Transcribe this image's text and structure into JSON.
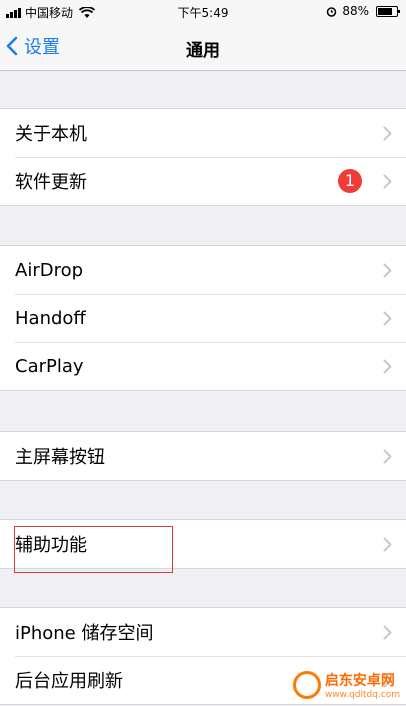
{
  "status_bar": {
    "carrier": "中国移动",
    "time": "下午5:49",
    "battery_percent": "88%",
    "battery_level": 0.88,
    "icons": [
      "signal-icon",
      "wifi-icon",
      "alarm-icon",
      "battery-icon"
    ]
  },
  "nav": {
    "back_label": "设置",
    "title": "通用"
  },
  "groups": [
    {
      "rows": [
        {
          "label": "关于本机"
        },
        {
          "label": "软件更新",
          "badge": "1"
        }
      ]
    },
    {
      "rows": [
        {
          "label": "AirDrop"
        },
        {
          "label": "Handoff"
        },
        {
          "label": "CarPlay"
        }
      ]
    },
    {
      "rows": [
        {
          "label": "主屏幕按钮"
        }
      ]
    },
    {
      "rows": [
        {
          "label": "辅助功能"
        }
      ]
    },
    {
      "rows": [
        {
          "label": "iPhone 储存空间"
        },
        {
          "label": "后台应用刷新"
        }
      ]
    }
  ],
  "watermark": {
    "title": "启东安卓网",
    "url": "www.qdltdq.com"
  },
  "colors": {
    "accent": "#1a7df3",
    "badge": "#f13b36",
    "highlight": "#d93b3b",
    "background": "#efeff4"
  }
}
